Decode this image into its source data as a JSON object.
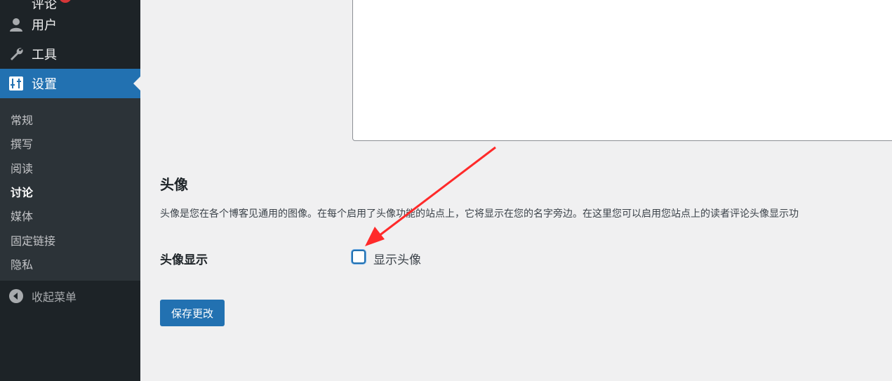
{
  "sidebar": {
    "partial_top_label": "评论",
    "items": [
      {
        "label": "用户",
        "icon": "user-icon"
      },
      {
        "label": "工具",
        "icon": "wrench-icon"
      },
      {
        "label": "设置",
        "icon": "settings-icon",
        "active": true
      }
    ],
    "submenu": [
      {
        "label": "常规"
      },
      {
        "label": "撰写"
      },
      {
        "label": "阅读"
      },
      {
        "label": "讨论",
        "current": true
      },
      {
        "label": "媒体"
      },
      {
        "label": "固定链接"
      },
      {
        "label": "隐私"
      }
    ],
    "collapse_label": "收起菜单"
  },
  "main": {
    "section_title": "头像",
    "section_desc": "头像是您在各个博客见通用的图像。在每个启用了头像功能的站点上，它将显示在您的名字旁边。在这里您可以启用您站点上的读者评论头像显示功",
    "avatar_display_label": "头像显示",
    "show_avatars_label": "显示头像",
    "show_avatars_checked": false,
    "save_button_label": "保存更改"
  },
  "colors": {
    "sidebar_bg": "#1d2327",
    "submenu_bg": "#2c3338",
    "accent": "#2271b1",
    "annotation_arrow": "#ff2a2a"
  }
}
